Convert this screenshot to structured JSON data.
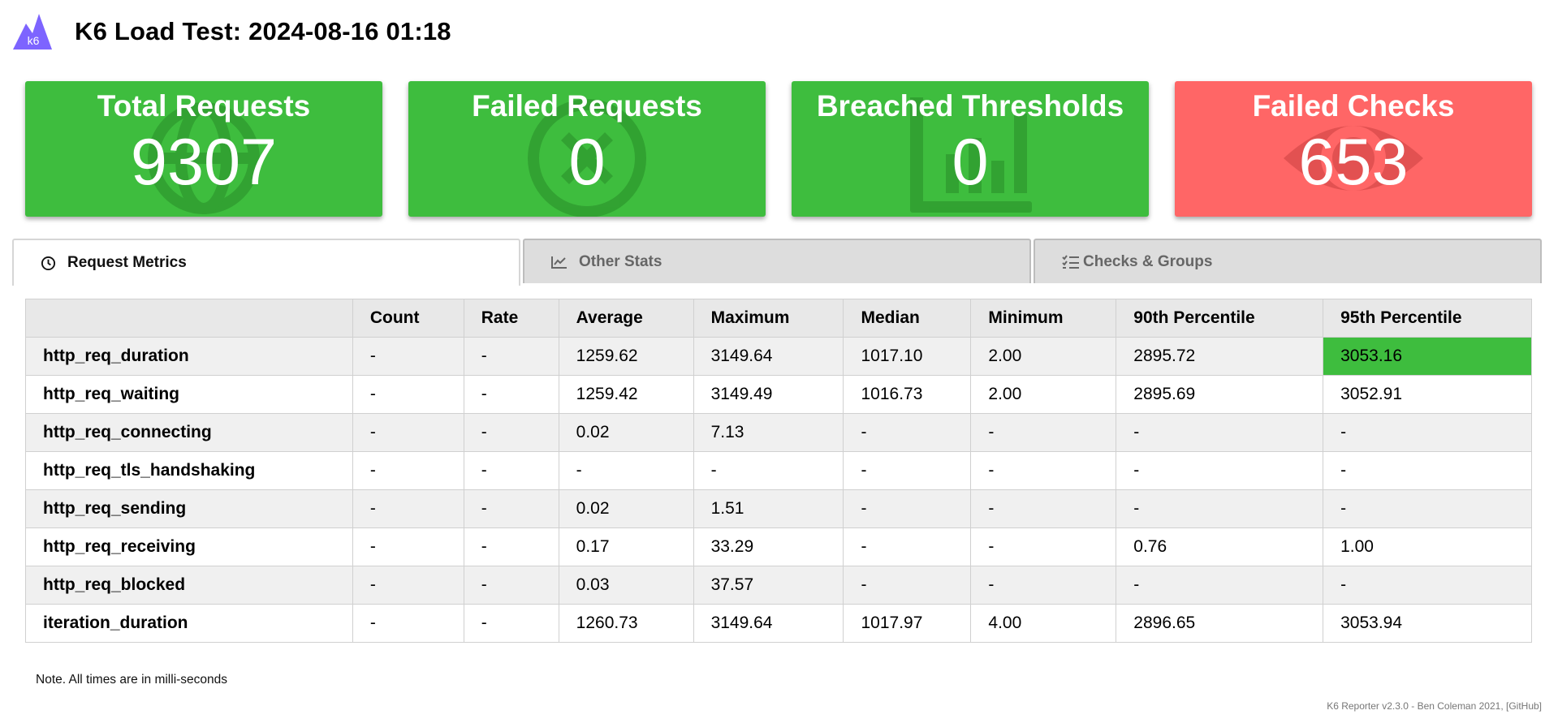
{
  "header": {
    "logo_text": "k6",
    "title": "K6 Load Test: 2024-08-16 01:18"
  },
  "cards": [
    {
      "title": "Total Requests",
      "value": "9307",
      "status": "green",
      "icon": "globe-icon"
    },
    {
      "title": "Failed Requests",
      "value": "0",
      "status": "green",
      "icon": "x-circle-icon"
    },
    {
      "title": "Breached Thresholds",
      "value": "0",
      "status": "green",
      "icon": "bar-chart-icon"
    },
    {
      "title": "Failed Checks",
      "value": "653",
      "status": "red",
      "icon": "eye-icon"
    }
  ],
  "colors": {
    "green": "#3ebd3e",
    "red": "#ff6666"
  },
  "tabs": [
    {
      "label": "Request Metrics",
      "icon": "clock-icon",
      "active": true
    },
    {
      "label": "Other Stats",
      "icon": "line-chart-icon",
      "active": false
    },
    {
      "label": "Checks & Groups",
      "icon": "checklist-icon",
      "active": false
    }
  ],
  "table": {
    "headers": [
      "",
      "Count",
      "Rate",
      "Average",
      "Maximum",
      "Median",
      "Minimum",
      "90th Percentile",
      "95th Percentile"
    ],
    "rows": [
      {
        "cells": [
          "http_req_duration",
          "-",
          "-",
          "1259.62",
          "3149.64",
          "1017.10",
          "2.00",
          "2895.72",
          "3053.16"
        ],
        "highlight": [
          8
        ]
      },
      {
        "cells": [
          "http_req_waiting",
          "-",
          "-",
          "1259.42",
          "3149.49",
          "1016.73",
          "2.00",
          "2895.69",
          "3052.91"
        ],
        "highlight": []
      },
      {
        "cells": [
          "http_req_connecting",
          "-",
          "-",
          "0.02",
          "7.13",
          "-",
          "-",
          "-",
          "-"
        ],
        "highlight": []
      },
      {
        "cells": [
          "http_req_tls_handshaking",
          "-",
          "-",
          "-",
          "-",
          "-",
          "-",
          "-",
          "-"
        ],
        "highlight": []
      },
      {
        "cells": [
          "http_req_sending",
          "-",
          "-",
          "0.02",
          "1.51",
          "-",
          "-",
          "-",
          "-"
        ],
        "highlight": []
      },
      {
        "cells": [
          "http_req_receiving",
          "-",
          "-",
          "0.17",
          "33.29",
          "-",
          "-",
          "0.76",
          "1.00"
        ],
        "highlight": []
      },
      {
        "cells": [
          "http_req_blocked",
          "-",
          "-",
          "0.03",
          "37.57",
          "-",
          "-",
          "-",
          "-"
        ],
        "highlight": []
      },
      {
        "cells": [
          "iteration_duration",
          "-",
          "-",
          "1260.73",
          "3149.64",
          "1017.97",
          "4.00",
          "2896.65",
          "3053.94"
        ],
        "highlight": []
      }
    ]
  },
  "note": "Note. All times are in milli-seconds",
  "footer": "K6 Reporter v2.3.0 - Ben Coleman 2021, [GitHub]"
}
